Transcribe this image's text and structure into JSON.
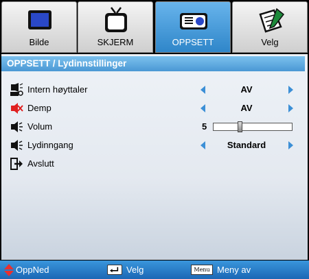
{
  "tabs": [
    {
      "label": "Bilde",
      "icon": "monitor-icon",
      "active": false
    },
    {
      "label": "SKJERM",
      "icon": "tv-icon",
      "active": false
    },
    {
      "label": "OPPSETT",
      "icon": "projector-icon",
      "active": true
    },
    {
      "label": "Velg",
      "icon": "notepad-pen-icon",
      "active": false
    }
  ],
  "breadcrumb": "OPPSETT / Lydinnstillinger",
  "rows": {
    "internal_speaker": {
      "label": "Intern høyttaler",
      "value": "AV"
    },
    "mute": {
      "label": "Demp",
      "value": "AV"
    },
    "volume": {
      "label": "Volum",
      "value": "5",
      "level_fraction": 0.33
    },
    "audio_input": {
      "label": "Lydinngang",
      "value": "Standard"
    },
    "exit": {
      "label": "Avslutt"
    }
  },
  "help": {
    "updown_label": "OppNed",
    "select_label": "Velg",
    "menu_key_text": "Menu",
    "menu_label": "Meny av"
  },
  "colors": {
    "accent": "#3c8fd6",
    "active_tab": "#2f86c9",
    "mute_icon": "#e02020"
  }
}
